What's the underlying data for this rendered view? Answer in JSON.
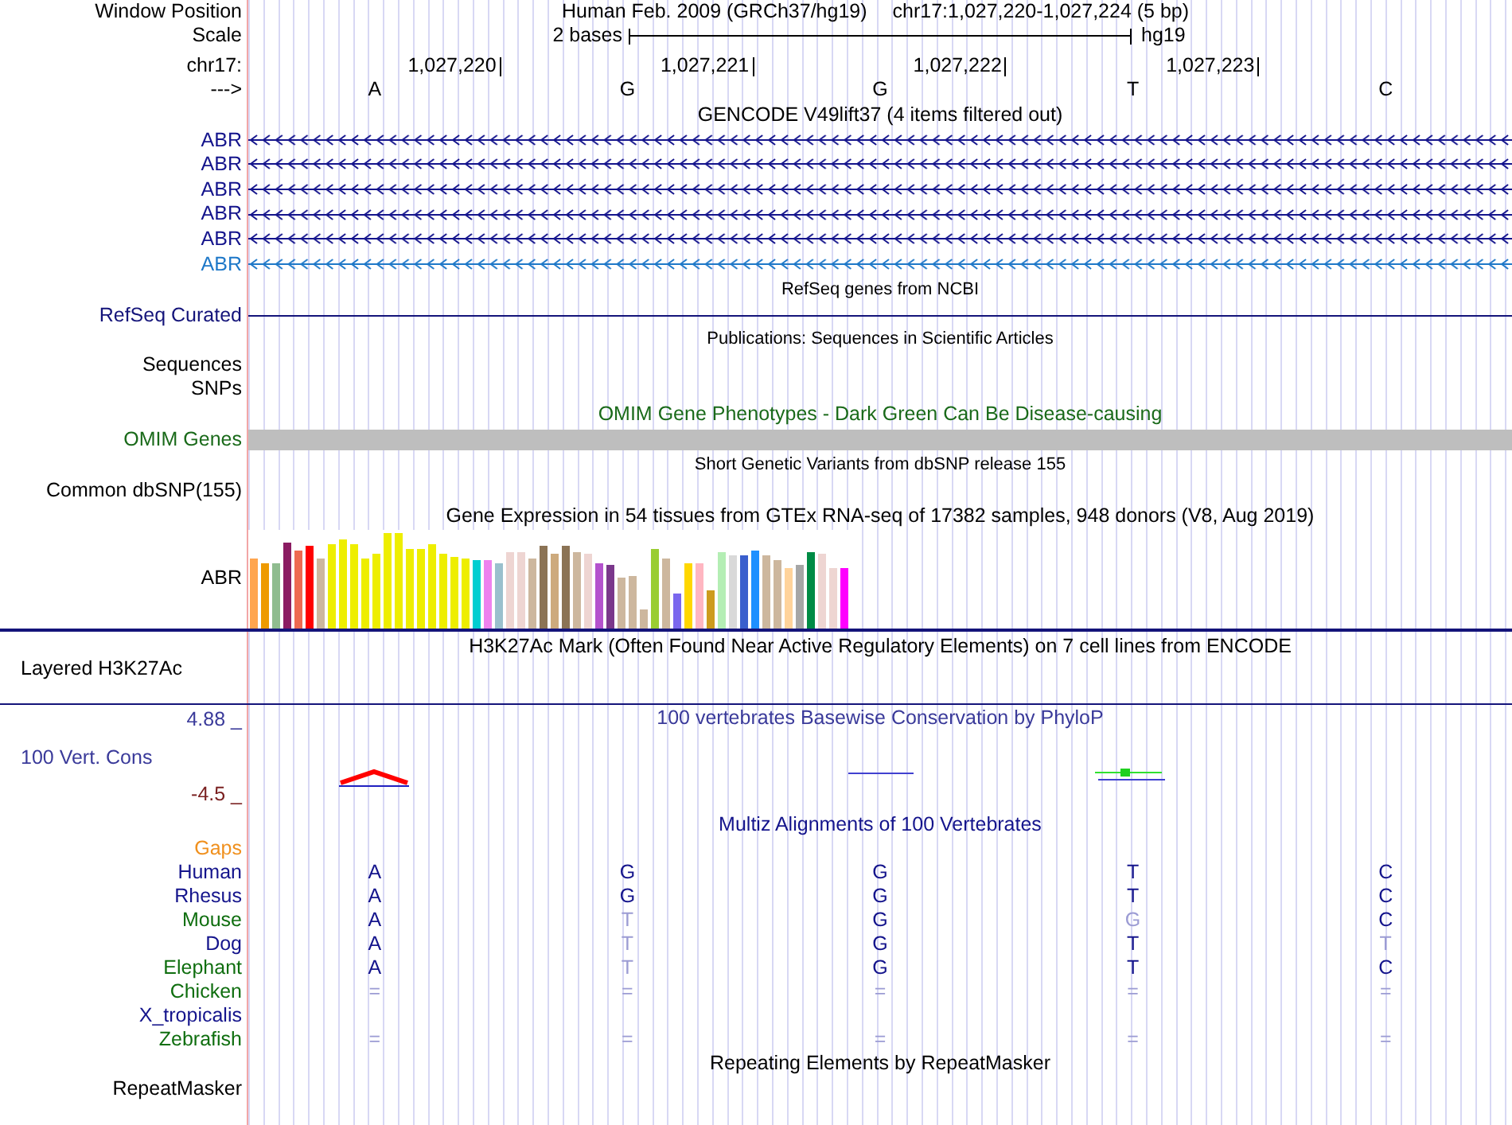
{
  "position": {
    "label": "Window Position",
    "assembly": "Human Feb. 2009 (GRCh37/hg19)",
    "range": "chr17:1,027,220-1,027,224 (5 bp)"
  },
  "scale": {
    "label": "Scale",
    "bar_label": "2 bases",
    "assembly": "hg19"
  },
  "ruler": {
    "label": "chr17:",
    "ticks": [
      "1,027,220",
      "1,027,221",
      "1,027,222",
      "1,027,223"
    ]
  },
  "sequence": {
    "label": "--->",
    "bases": [
      "A",
      "G",
      "G",
      "T",
      "C"
    ]
  },
  "gencode": {
    "title": "GENCODE V49lift37 (4 items filtered out)",
    "genes": [
      {
        "name": "ABR",
        "color": "#14148c"
      },
      {
        "name": "ABR",
        "color": "#14148c"
      },
      {
        "name": "ABR",
        "color": "#14148c"
      },
      {
        "name": "ABR",
        "color": "#14148c"
      },
      {
        "name": "ABR",
        "color": "#14148c"
      },
      {
        "name": "ABR",
        "color": "#1e78c8"
      }
    ]
  },
  "refseq": {
    "title": "RefSeq genes from NCBI",
    "label": "RefSeq Curated"
  },
  "publications": {
    "title": "Publications: Sequences in Scientific Articles",
    "labels": [
      "Sequences",
      "SNPs"
    ]
  },
  "omim": {
    "title": "OMIM Gene Phenotypes - Dark Green Can Be Disease-causing",
    "label": "OMIM Genes"
  },
  "dbsnp": {
    "title": "Short Genetic Variants from dbSNP release 155",
    "label": "Common dbSNP(155)"
  },
  "gtex": {
    "title": "Gene Expression in 54 tissues from GTEx RNA-seq of 17382 samples, 948 donors (V8, Aug 2019)",
    "label": "ABR"
  },
  "h3k27ac": {
    "title": "H3K27Ac Mark (Often Found Near Active Regulatory Elements) on 7 cell lines from ENCODE",
    "label": "Layered H3K27Ac"
  },
  "phylop": {
    "title": "100 vertebrates Basewise Conservation by PhyloP",
    "label": "100 Vert. Cons",
    "ymax": "4.88 _",
    "ymin": "-4.5 _"
  },
  "multiz": {
    "title": "Multiz Alignments of 100 Vertebrates",
    "gaps_label": "Gaps",
    "species": [
      {
        "name": "Human",
        "color": "#14148c",
        "bases": [
          {
            "text": "A",
            "faded": false
          },
          {
            "text": "G",
            "faded": false
          },
          {
            "text": "G",
            "faded": false
          },
          {
            "text": "T",
            "faded": false
          },
          {
            "text": "C",
            "faded": false
          }
        ]
      },
      {
        "name": "Rhesus",
        "color": "#14148c",
        "bases": [
          {
            "text": "A",
            "faded": false
          },
          {
            "text": "G",
            "faded": false
          },
          {
            "text": "G",
            "faded": false
          },
          {
            "text": "T",
            "faded": false
          },
          {
            "text": "C",
            "faded": false
          }
        ]
      },
      {
        "name": "Mouse",
        "color": "#0f6e0f",
        "bases": [
          {
            "text": "A",
            "faded": false
          },
          {
            "text": "T",
            "faded": true
          },
          {
            "text": "G",
            "faded": false
          },
          {
            "text": "G",
            "faded": true
          },
          {
            "text": "C",
            "faded": false
          }
        ]
      },
      {
        "name": "Dog",
        "color": "#14148c",
        "bases": [
          {
            "text": "A",
            "faded": false
          },
          {
            "text": "T",
            "faded": true
          },
          {
            "text": "G",
            "faded": false
          },
          {
            "text": "T",
            "faded": false
          },
          {
            "text": "T",
            "faded": true
          }
        ]
      },
      {
        "name": "Elephant",
        "color": "#0f6e0f",
        "bases": [
          {
            "text": "A",
            "faded": false
          },
          {
            "text": "T",
            "faded": true
          },
          {
            "text": "G",
            "faded": false
          },
          {
            "text": "T",
            "faded": false
          },
          {
            "text": "C",
            "faded": false
          }
        ]
      },
      {
        "name": "Chicken",
        "color": "#0f6e0f",
        "bases": [
          {
            "text": "=",
            "faded": true
          },
          {
            "text": "=",
            "faded": true
          },
          {
            "text": "=",
            "faded": true
          },
          {
            "text": "=",
            "faded": true
          },
          {
            "text": "=",
            "faded": true
          }
        ]
      },
      {
        "name": "X_tropicalis",
        "color": "#14148c"
      },
      {
        "name": "Zebrafish",
        "color": "#0f6e0f",
        "bases": [
          {
            "text": "=",
            "faded": true
          },
          {
            "text": "=",
            "faded": true
          },
          {
            "text": "=",
            "faded": true
          },
          {
            "text": "=",
            "faded": true
          },
          {
            "text": "=",
            "faded": true
          }
        ]
      }
    ]
  },
  "repeatmasker": {
    "title": "Repeating Elements by RepeatMasker",
    "label": "RepeatMasker"
  }
}
